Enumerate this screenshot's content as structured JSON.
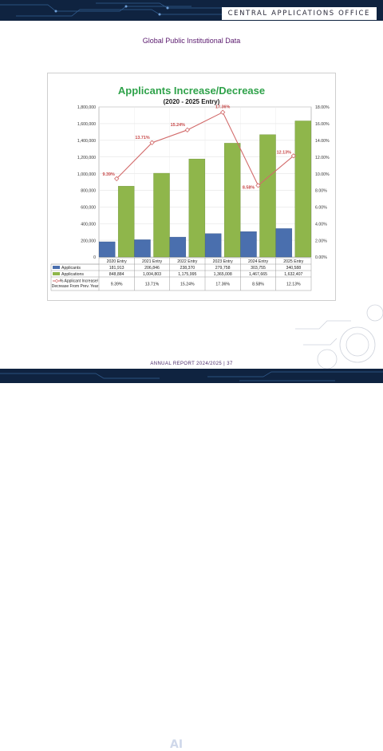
{
  "header": {
    "office_name": "CENTRAL APPLICATIONS OFFICE"
  },
  "page": {
    "heading": "Global Public Institutional Data"
  },
  "footer": {
    "text": "ANNUAL REPORT 2024/2025 | 37",
    "ai_mark": "AI"
  },
  "colors": {
    "applicants": "#4a6fae",
    "applications": "#8fb64b",
    "percent_line": "#d26a6a",
    "title": "#2fa24a",
    "banner": "#0f2340"
  },
  "chart_data": {
    "type": "bar",
    "title": "Applicants Increase/Decrease",
    "subtitle": "(2020 - 2025 Entry)",
    "categories": [
      "2020 Entry",
      "2021 Entry",
      "2022 Entry",
      "2023 Entry",
      "2024 Entry",
      "2025 Entry"
    ],
    "series": [
      {
        "name": "Applicants",
        "type": "bar",
        "axis": "left",
        "values": [
          181913,
          206846,
          238370,
          279758,
          303755,
          340588
        ],
        "labels": [
          "181,913",
          "206,846",
          "238,370",
          "279,758",
          "303,755",
          "340,588"
        ]
      },
      {
        "name": "Applications",
        "type": "bar",
        "axis": "left",
        "values": [
          848884,
          1004803,
          1175995,
          1365008,
          1467665,
          1632407
        ],
        "labels": [
          "848,884",
          "1,004,803",
          "1,175,995",
          "1,365,008",
          "1,467,665",
          "1,632,407"
        ]
      },
      {
        "name": "% Applicant Increase/ Decrease From Prev. Year",
        "type": "line",
        "axis": "right",
        "values": [
          9.39,
          13.71,
          15.24,
          17.36,
          8.58,
          12.13
        ],
        "labels": [
          "9.39%",
          "13.71%",
          "15.24%",
          "17.36%",
          "8.58%",
          "12.13%"
        ]
      }
    ],
    "y_left": {
      "min": 0,
      "max": 1800000,
      "step": 200000,
      "ticks": [
        "0",
        "200,000",
        "400,000",
        "600,000",
        "800,000",
        "1,000,000",
        "1,200,000",
        "1,400,000",
        "1,600,000",
        "1,800,000"
      ]
    },
    "y_right": {
      "min": 0,
      "max": 18,
      "step": 2,
      "ticks": [
        "0.00%",
        "2.00%",
        "4.00%",
        "6.00%",
        "8.00%",
        "10.00%",
        "12.00%",
        "14.00%",
        "16.00%",
        "18.00%"
      ]
    },
    "grid": true,
    "legend": "data table below chart"
  }
}
